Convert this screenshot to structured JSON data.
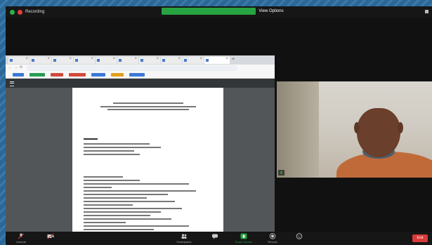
{
  "topbar": {
    "recording_label": "Recording",
    "share_banner": null,
    "view_options": "View Options",
    "view_right": null
  },
  "browser": {
    "tabs": [
      null,
      null,
      null,
      null,
      null,
      null,
      null,
      null,
      null,
      null,
      null
    ],
    "url": null,
    "bookmarks": [
      {
        "color": "#3b79d8"
      },
      {
        "color": "#2a9d56"
      },
      {
        "color": "#d04a3a"
      },
      {
        "color": "#d04a3a"
      },
      {
        "color": "#3b79d8"
      },
      {
        "color": "#e0a020"
      },
      {
        "color": "#3b79d8"
      }
    ]
  },
  "pdf": {
    "title": null,
    "page_nav": null,
    "zoom": null,
    "icons": null
  },
  "document": {
    "heading": null,
    "subheading": null,
    "section": null,
    "part1": null,
    "part1_title": null,
    "part2": null,
    "part2_title": null
  },
  "participant": {
    "name": null
  },
  "toolbar": {
    "unmute": "Unmute",
    "start_video": null,
    "participants": "Participants",
    "participants_count": null,
    "chat": null,
    "chat_badge": null,
    "share_screen": "Share Screen",
    "record": "Record",
    "reactions": null,
    "end": "End"
  },
  "colors": {
    "share_green": "#27a341",
    "end_red": "#d83a3a",
    "recording_red": "#e0403b"
  }
}
